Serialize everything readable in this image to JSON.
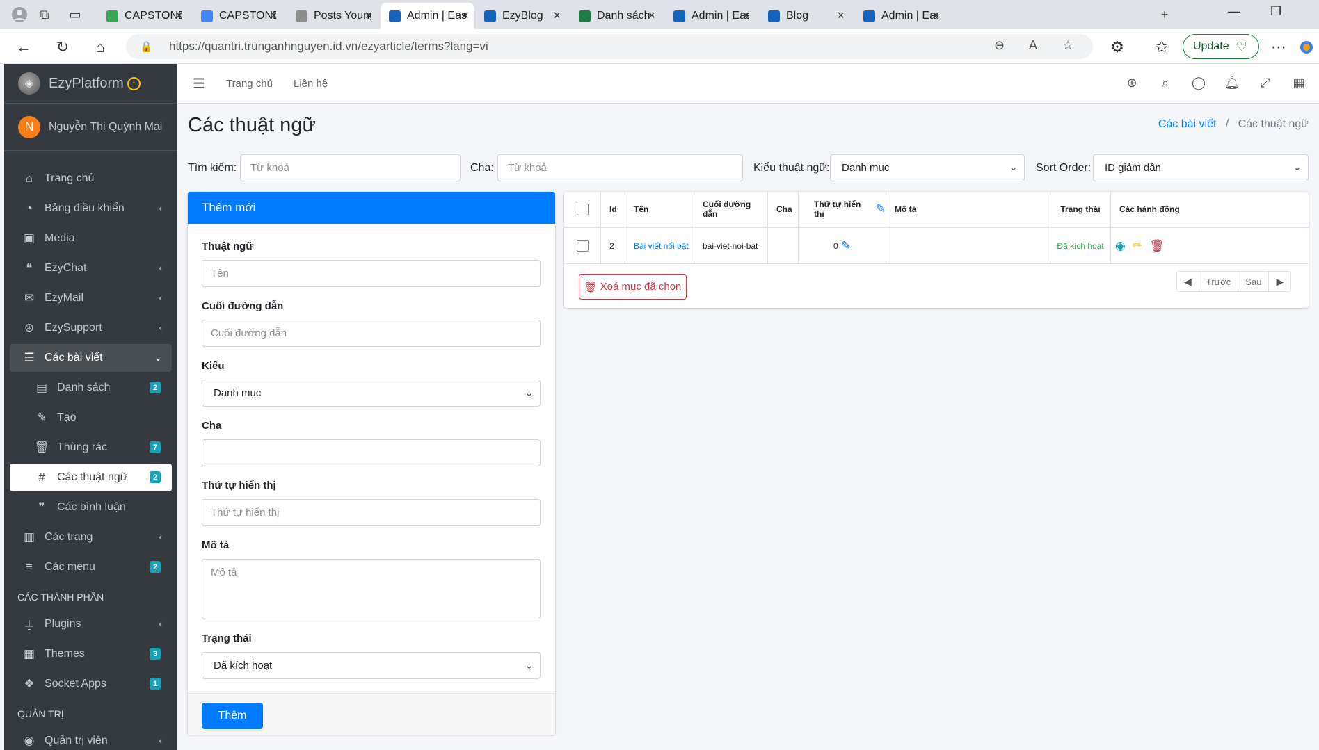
{
  "browser": {
    "tabs": [
      {
        "title": "CAPSTONE Pl",
        "fav": "#34a853"
      },
      {
        "title": "CAPSTONE Pl",
        "fav": "#4285f4"
      },
      {
        "title": "Posts Young I",
        "fav": "#8d8d8d"
      },
      {
        "title": "Admin | Easy",
        "fav": "#1565c0"
      },
      {
        "title": "EzyBlog",
        "fav": "#1565c0"
      },
      {
        "title": "Danh sách cá",
        "fav": "#1e7e45"
      },
      {
        "title": "Admin | Easy",
        "fav": "#1565c0"
      },
      {
        "title": "Blog",
        "fav": "#1565c0"
      },
      {
        "title": "Admin | Easy",
        "fav": "#1565c0"
      }
    ],
    "url": "https://quantri.trunganhnguyen.id.vn/ezyarticle/terms?lang=vi",
    "update_label": "Update"
  },
  "sidebar": {
    "brand": "EzyPlatform",
    "user_initial": "N",
    "user_name": "Nguyễn Thị Quỳnh Mai",
    "items": [
      {
        "label": "Trang chủ",
        "icon": "home-icon",
        "glyph": "⌂"
      },
      {
        "label": "Bảng điều khiển",
        "icon": "dashboard-icon",
        "glyph": "◔",
        "chevron": true
      },
      {
        "label": "Media",
        "icon": "image-icon",
        "glyph": "▣"
      },
      {
        "label": "EzyChat",
        "icon": "chat-icon",
        "glyph": "❝",
        "chevron": true
      },
      {
        "label": "EzyMail",
        "icon": "mail-icon",
        "glyph": "✉",
        "chevron": true
      },
      {
        "label": "EzySupport",
        "icon": "support-icon",
        "glyph": "⊛",
        "chevron": true
      },
      {
        "label": "Các bài viết",
        "icon": "article-icon",
        "glyph": "☰",
        "chevron": true
      },
      {
        "label": "Danh sách",
        "icon": "book-icon",
        "glyph": "▤",
        "badge": "2",
        "badge_color": "#17a2b8"
      },
      {
        "label": "Tạo",
        "icon": "edit-icon",
        "glyph": "✎"
      },
      {
        "label": "Thùng rác",
        "icon": "trash-icon",
        "glyph": "🗑",
        "badge": "7",
        "badge_color": "#17a2b8"
      },
      {
        "label": "Các thuật ngữ",
        "icon": "hashtag-icon",
        "glyph": "#",
        "badge": "2",
        "badge_color": "#17a2b8"
      },
      {
        "label": "Các bình luận",
        "icon": "comments-icon",
        "glyph": "❞"
      },
      {
        "label": "Các trang",
        "icon": "columns-icon",
        "glyph": "▥",
        "chevron": true
      },
      {
        "label": "Các menu",
        "icon": "bars-icon",
        "glyph": "≡",
        "badge": "2",
        "badge_color": "#17a2b8"
      },
      {
        "label": "Plugins",
        "icon": "plug-icon",
        "glyph": "⏚",
        "chevron": true
      },
      {
        "label": "Themes",
        "icon": "themes-icon",
        "glyph": "▦",
        "badge": "3",
        "badge_color": "#17a2b8"
      },
      {
        "label": "Socket Apps",
        "icon": "cubes-icon",
        "glyph": "❖",
        "badge": "1",
        "badge_color": "#17a2b8"
      },
      {
        "label": "Quản trị viên",
        "icon": "user-circle-icon",
        "glyph": "◉",
        "chevron": true
      }
    ],
    "section_components": "CÁC THÀNH PHẦN",
    "section_admin": "QUẢN TRỊ"
  },
  "topnav": {
    "home": "Trang chủ",
    "contact": "Liên hệ"
  },
  "page": {
    "title": "Các thuật ngữ",
    "breadcrumb_parent": "Các bài viết",
    "breadcrumb_current": "Các thuật ngữ"
  },
  "filters": {
    "search_label": "Tìm kiếm:",
    "search_placeholder": "Từ khoá",
    "parent_label": "Cha:",
    "parent_placeholder": "Từ khoá",
    "type_label": "Kiểu thuật ngữ:",
    "type_value": "Danh mục",
    "sort_label": "Sort Order:",
    "sort_value": "ID giảm dần"
  },
  "form": {
    "header": "Thêm mới",
    "term_label": "Thuật ngữ",
    "term_placeholder": "Tên",
    "slug_label": "Cuối đường dẫn",
    "slug_placeholder": "Cuối đường dẫn",
    "type_label": "Kiểu",
    "type_value": "Danh mục",
    "parent_label": "Cha",
    "order_label": "Thứ tự hiển thị",
    "order_placeholder": "Thứ tự hiển thị",
    "desc_label": "Mô tả",
    "desc_placeholder": "Mô tả",
    "status_label": "Trạng thái",
    "status_value": "Đã kích hoạt",
    "submit": "Thêm"
  },
  "table": {
    "headers": {
      "id": "Id",
      "name": "Tên",
      "slug": "Cuối đường dẫn",
      "parent": "Cha",
      "order": "Thứ tự hiển thị",
      "desc": "Mô tả",
      "status": "Trạng thái",
      "actions": "Các hành động"
    },
    "rows": [
      {
        "id": "2",
        "name": "Bài viết nổi bật",
        "slug": "bai-viet-noi-bat",
        "parent": "",
        "order": "0",
        "desc": "",
        "status": "Đã kích hoạt"
      }
    ],
    "delete_selected": "Xoá mục đã chọn",
    "prev": "Trước",
    "next": "Sau"
  }
}
